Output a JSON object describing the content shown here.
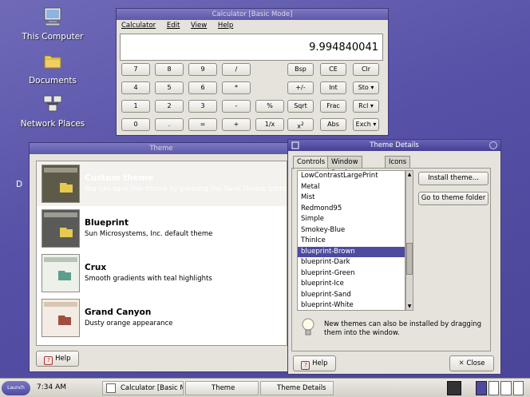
{
  "desktop": {
    "icons": [
      {
        "label": "This Computer",
        "icon": "computer-icon"
      },
      {
        "label": "Documents",
        "icon": "folder-icon"
      },
      {
        "label": "Network Places",
        "icon": "network-icon"
      }
    ],
    "partial_label": "D"
  },
  "calculator": {
    "title": "Calculator [Basic Mode]",
    "menu": [
      "Calculator",
      "Edit",
      "View",
      "Help"
    ],
    "display": "9.994840041",
    "buttons": {
      "row1": [
        "7",
        "8",
        "9",
        "/"
      ],
      "row2": [
        "4",
        "5",
        "6",
        "*"
      ],
      "row3": [
        "1",
        "2",
        "3",
        "-",
        "%"
      ],
      "row4": [
        "0",
        ".",
        "=",
        "+",
        "1/x"
      ],
      "side_row1": [
        "Bsp",
        "CE",
        "Clr"
      ],
      "side_row2": [
        "+/-",
        "Int",
        "Sto"
      ],
      "side_row3": [
        "Sqrt",
        "Frac",
        "Rcl"
      ],
      "side_row4": [
        "x2",
        "Abs",
        "Exch"
      ]
    }
  },
  "theme": {
    "title": "Theme",
    "themes": [
      {
        "name": "Custom theme",
        "description": "You can save this theme by pressing the Save Theme butto"
      },
      {
        "name": "Blueprint",
        "description": "Sun Microsystems, Inc. default theme"
      },
      {
        "name": "Crux",
        "description": "Smooth gradients with teal highlights"
      },
      {
        "name": "Grand Canyon",
        "description": "Dusty orange appearance"
      }
    ],
    "help_label": "Help"
  },
  "details": {
    "title": "Theme Details",
    "tabs": [
      "Controls",
      "Window Border",
      "Icons"
    ],
    "items": [
      "LowContrastLargePrint",
      "Metal",
      "Mist",
      "Redmond95",
      "Simple",
      "Smokey-Blue",
      "ThinIce",
      "blueprint-Brown",
      "blueprint-Dark",
      "blueprint-Green",
      "blueprint-Ice",
      "blueprint-Sand",
      "blueprint-White"
    ],
    "selected": "blueprint-Brown",
    "install_label": "Install theme...",
    "folder_label": "Go to theme folder",
    "hint": "New themes can also be installed by dragging them into the window.",
    "help_label": "Help",
    "close_label": "Close"
  },
  "taskbar": {
    "launch_label": "Launch",
    "time": "7:34 AM",
    "tasks": [
      "Calculator [Basic M",
      "Theme",
      "Theme Details"
    ]
  },
  "colors": {
    "desktop": "#5650a6",
    "selection": "#4e4aa0",
    "titlebar": "#5d58a8"
  }
}
